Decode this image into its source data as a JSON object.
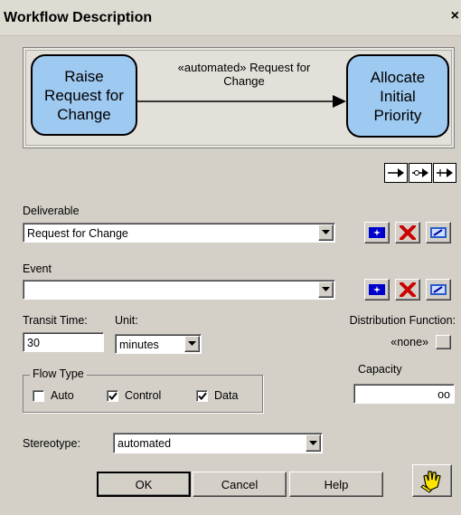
{
  "window": {
    "title": "Workflow Description",
    "close_glyph": "×"
  },
  "diagram": {
    "source_node": "Raise\nRequest for\nChange",
    "edge_label": "«automated» Request for\nChange",
    "target_node": "Allocate\nInitial\nPriority",
    "node_fill": "#9ec9f0"
  },
  "toolbar": {
    "arrow_icons": [
      "arrow-right-icon",
      "arrow-circle-right-icon",
      "arrow-cross-right-icon"
    ]
  },
  "deliverable": {
    "label": "Deliverable",
    "value": "Request for Change",
    "actions": [
      "new-icon",
      "delete-icon",
      "edit-icon"
    ]
  },
  "event": {
    "label": "Event",
    "value": ""
  },
  "transit": {
    "label": "Transit Time:",
    "value": "30"
  },
  "unit": {
    "label": "Unit:",
    "value": "minutes"
  },
  "distribution": {
    "label": "Distribution Function:",
    "value": "«none»"
  },
  "flow_type": {
    "label": "Flow Type",
    "options": [
      {
        "label": "Auto",
        "checked": false
      },
      {
        "label": "Control",
        "checked": true
      },
      {
        "label": "Data",
        "checked": true
      }
    ]
  },
  "capacity": {
    "label": "Capacity",
    "value": "oo"
  },
  "stereotype": {
    "label": "Stereotype:",
    "value": "automated"
  },
  "buttons": {
    "ok": "OK",
    "cancel": "Cancel",
    "help": "Help"
  },
  "colors": {
    "delete_red": "#cc0000",
    "new_blue": "#0000cc",
    "edit_blue": "#2a5ccc"
  }
}
